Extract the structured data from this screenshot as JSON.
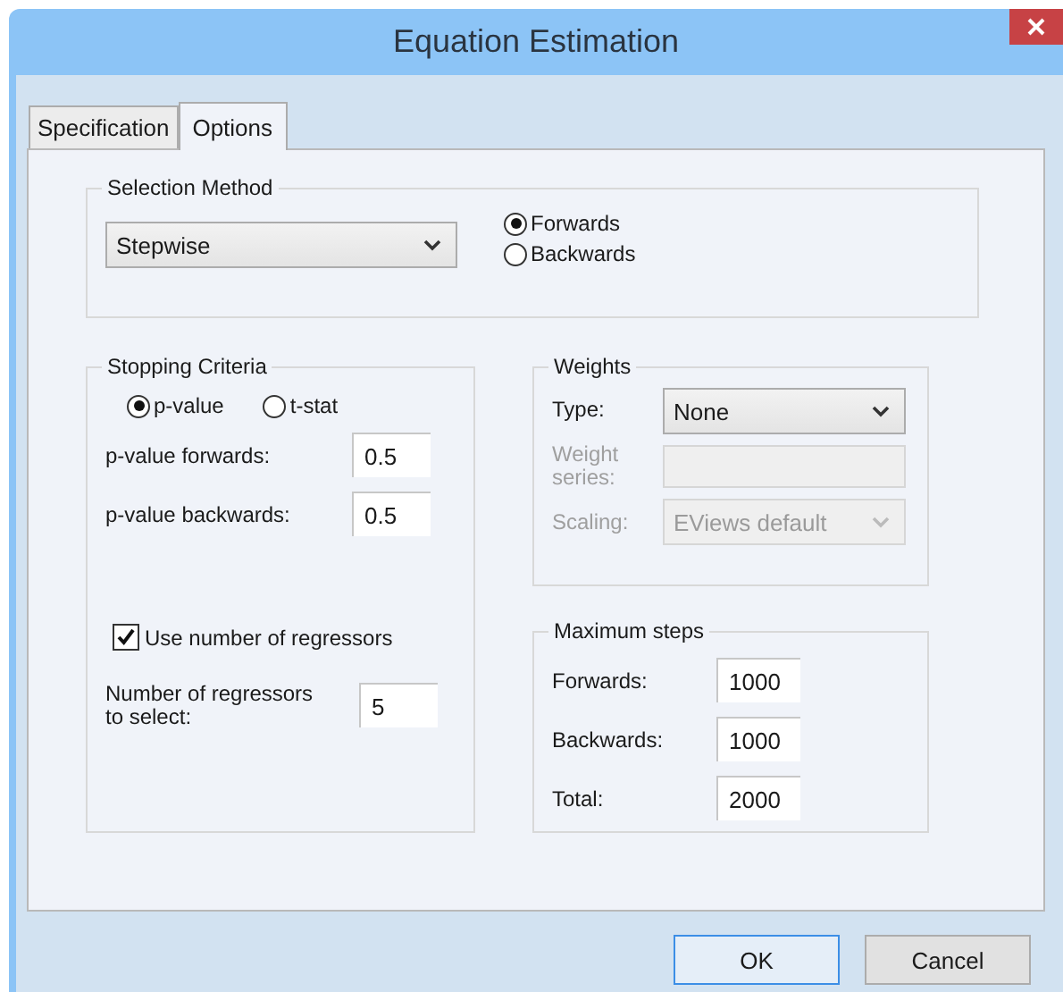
{
  "window": {
    "title": "Equation Estimation"
  },
  "tabs": [
    {
      "label": "Specification",
      "selected": false
    },
    {
      "label": "Options",
      "selected": true
    }
  ],
  "selection_method": {
    "legend": "Selection Method",
    "dropdown": {
      "value": "Stepwise"
    },
    "options": [
      {
        "label": "Forwards",
        "selected": true
      },
      {
        "label": "Backwards",
        "selected": false
      }
    ]
  },
  "stopping_criteria": {
    "legend": "Stopping Criteria",
    "criteria": [
      {
        "label": "p-value",
        "selected": true
      },
      {
        "label": "t-stat",
        "selected": false
      }
    ],
    "fields": [
      {
        "label": "p-value forwards:",
        "value": "0.5"
      },
      {
        "label": "p-value backwards:",
        "value": "0.5"
      }
    ],
    "checkbox": {
      "label": "Use number of regressors",
      "checked": true
    },
    "regressors_field": {
      "label": "Number of regressors to select:",
      "value": "5"
    }
  },
  "weights": {
    "legend": "Weights",
    "rows": [
      {
        "kind": "dropdown",
        "label": "Type:",
        "value": "None",
        "disabled": false
      },
      {
        "kind": "input",
        "label": "Weight series:",
        "disabled": true
      },
      {
        "kind": "dropdown",
        "label": "Scaling:",
        "value": "EViews default",
        "disabled": true
      }
    ]
  },
  "maximum_steps": {
    "legend": "Maximum steps",
    "fields": [
      {
        "label": "Forwards:",
        "value": "1000"
      },
      {
        "label": "Backwards:",
        "value": "1000"
      },
      {
        "label": "Total:",
        "value": "2000"
      }
    ]
  },
  "buttons": [
    {
      "label": "OK",
      "default": true
    },
    {
      "label": "Cancel",
      "default": false
    }
  ]
}
